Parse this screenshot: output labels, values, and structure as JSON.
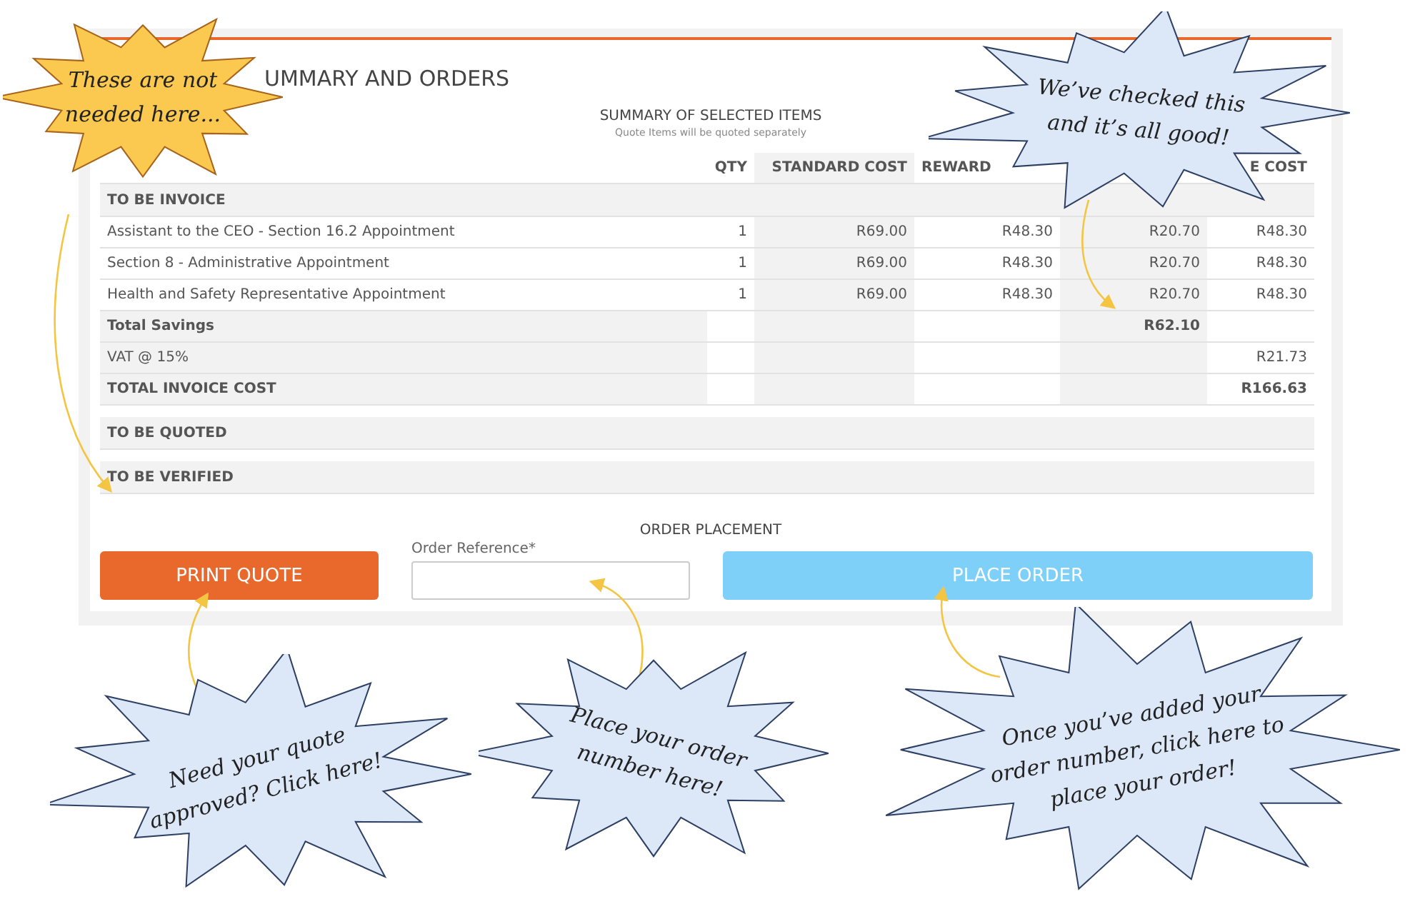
{
  "panel": {
    "title": "UMMARY AND ORDERS",
    "summary_title": "SUMMARY OF SELECTED ITEMS",
    "summary_note": "Quote Items will be quoted separately"
  },
  "table": {
    "headers": {
      "qty": "QTY",
      "standard_cost": "STANDARD COST",
      "column_3": "REWARD",
      "column_5": "E COST"
    },
    "group": "TO BE INVOICE",
    "rows": [
      {
        "name": "Assistant to the CEO - Section 16.2 Appointment",
        "qty": "1",
        "standard_cost": "R69.00",
        "column_3": "R48.30",
        "column_4": "R20.70",
        "column_5": "R48.30"
      },
      {
        "name": "Section 8 - Administrative Appointment",
        "qty": "1",
        "standard_cost": "R69.00",
        "column_3": "R48.30",
        "column_4": "R20.70",
        "column_5": "R48.30"
      },
      {
        "name": "Health and Safety Representative Appointment",
        "qty": "1",
        "standard_cost": "R69.00",
        "column_3": "R48.30",
        "column_4": "R20.70",
        "column_5": "R48.30"
      }
    ],
    "totals": [
      {
        "label": "Total Savings",
        "bold": true,
        "column_4": "R62.10"
      },
      {
        "label": "VAT @ 15%",
        "bold": false,
        "column_5": "R21.73"
      },
      {
        "label": "TOTAL INVOICE COST",
        "bold": true,
        "column_5": "R166.63"
      }
    ],
    "sections": [
      "TO BE QUOTED",
      "TO BE VERIFIED"
    ]
  },
  "order": {
    "title": "ORDER PLACEMENT",
    "print_button": "PRINT QUOTE",
    "reference": {
      "label": "Order Reference*"
    },
    "place_button": {
      "label": "PLACE ORDER",
      "disabled": true
    }
  },
  "callouts": [
    {
      "text": "These are not needed here...",
      "color": "#fbc94f"
    },
    {
      "text": "We’ve checked this and it’s all good!",
      "color": "#dce8f7"
    },
    {
      "text": "Need your quote approved? Click here!",
      "color": "#dce8f7"
    },
    {
      "text": "Place your order number here!",
      "color": "#dce8f7"
    },
    {
      "text": "Once you’ve added your order number, click here to place your order!",
      "color": "#dce8f7"
    }
  ]
}
